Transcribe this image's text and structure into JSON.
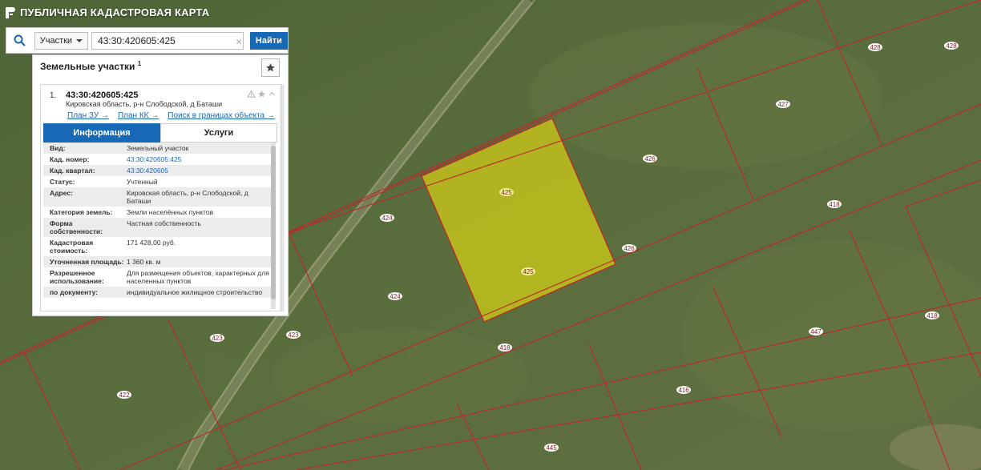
{
  "app": {
    "title": "ПУБЛИЧНАЯ КАДАСТРОВАЯ КАРТА"
  },
  "search": {
    "type_label": "Участки",
    "query": "43:30:420605:425",
    "button_label": "Найти"
  },
  "panel": {
    "title": "Земельные участки",
    "count": "1",
    "result": {
      "index": "1.",
      "cad_number": "43:30:420605:425",
      "address": "Кировская область, р-н Слободской, д Баташи",
      "links": [
        "План ЗУ →",
        "План КК →",
        "Поиск в границах объекта →"
      ],
      "tabs": [
        "Информация",
        "Услуги"
      ],
      "rows": [
        {
          "label": "Вид:",
          "value": "Земельный участок",
          "link": false
        },
        {
          "label": "Кад. номер:",
          "value": "43:30:420605:425",
          "link": true
        },
        {
          "label": "Кад. квартал:",
          "value": "43:30:420605",
          "link": true
        },
        {
          "label": "Статус:",
          "value": "Учтенный",
          "link": false
        },
        {
          "label": "Адрес:",
          "value": "Кировская область, р-н Слободской, д Баташи",
          "link": false
        },
        {
          "label": "Категория земель:",
          "value": "Земли населённых пунктов",
          "link": false
        },
        {
          "label": "Форма собственности:",
          "value": "Частная собственность",
          "link": false
        },
        {
          "label": "Кадастровая стоимость:",
          "value": "171 428,00 руб.",
          "link": false
        },
        {
          "label": "Уточненная площадь:",
          "value": "1 360 кв. м",
          "link": false
        },
        {
          "label": "Разрешенное использование:",
          "value": "Для размещения объектов, характерных для населенных пунктов",
          "link": false
        },
        {
          "label": "по документу:",
          "value": "индивидуальное жилищное строительство",
          "link": false
        }
      ]
    }
  },
  "map": {
    "highlight_color": "#c2c219",
    "boundary_color": "#c0242a",
    "parcel_labels": [
      "428",
      "428",
      "427",
      "426",
      "425",
      "425",
      "426",
      "424",
      "424",
      "418",
      "418",
      "418",
      "423",
      "423",
      "422",
      "447",
      "416",
      "445"
    ]
  },
  "colors": {
    "accent": "#1769b5"
  }
}
